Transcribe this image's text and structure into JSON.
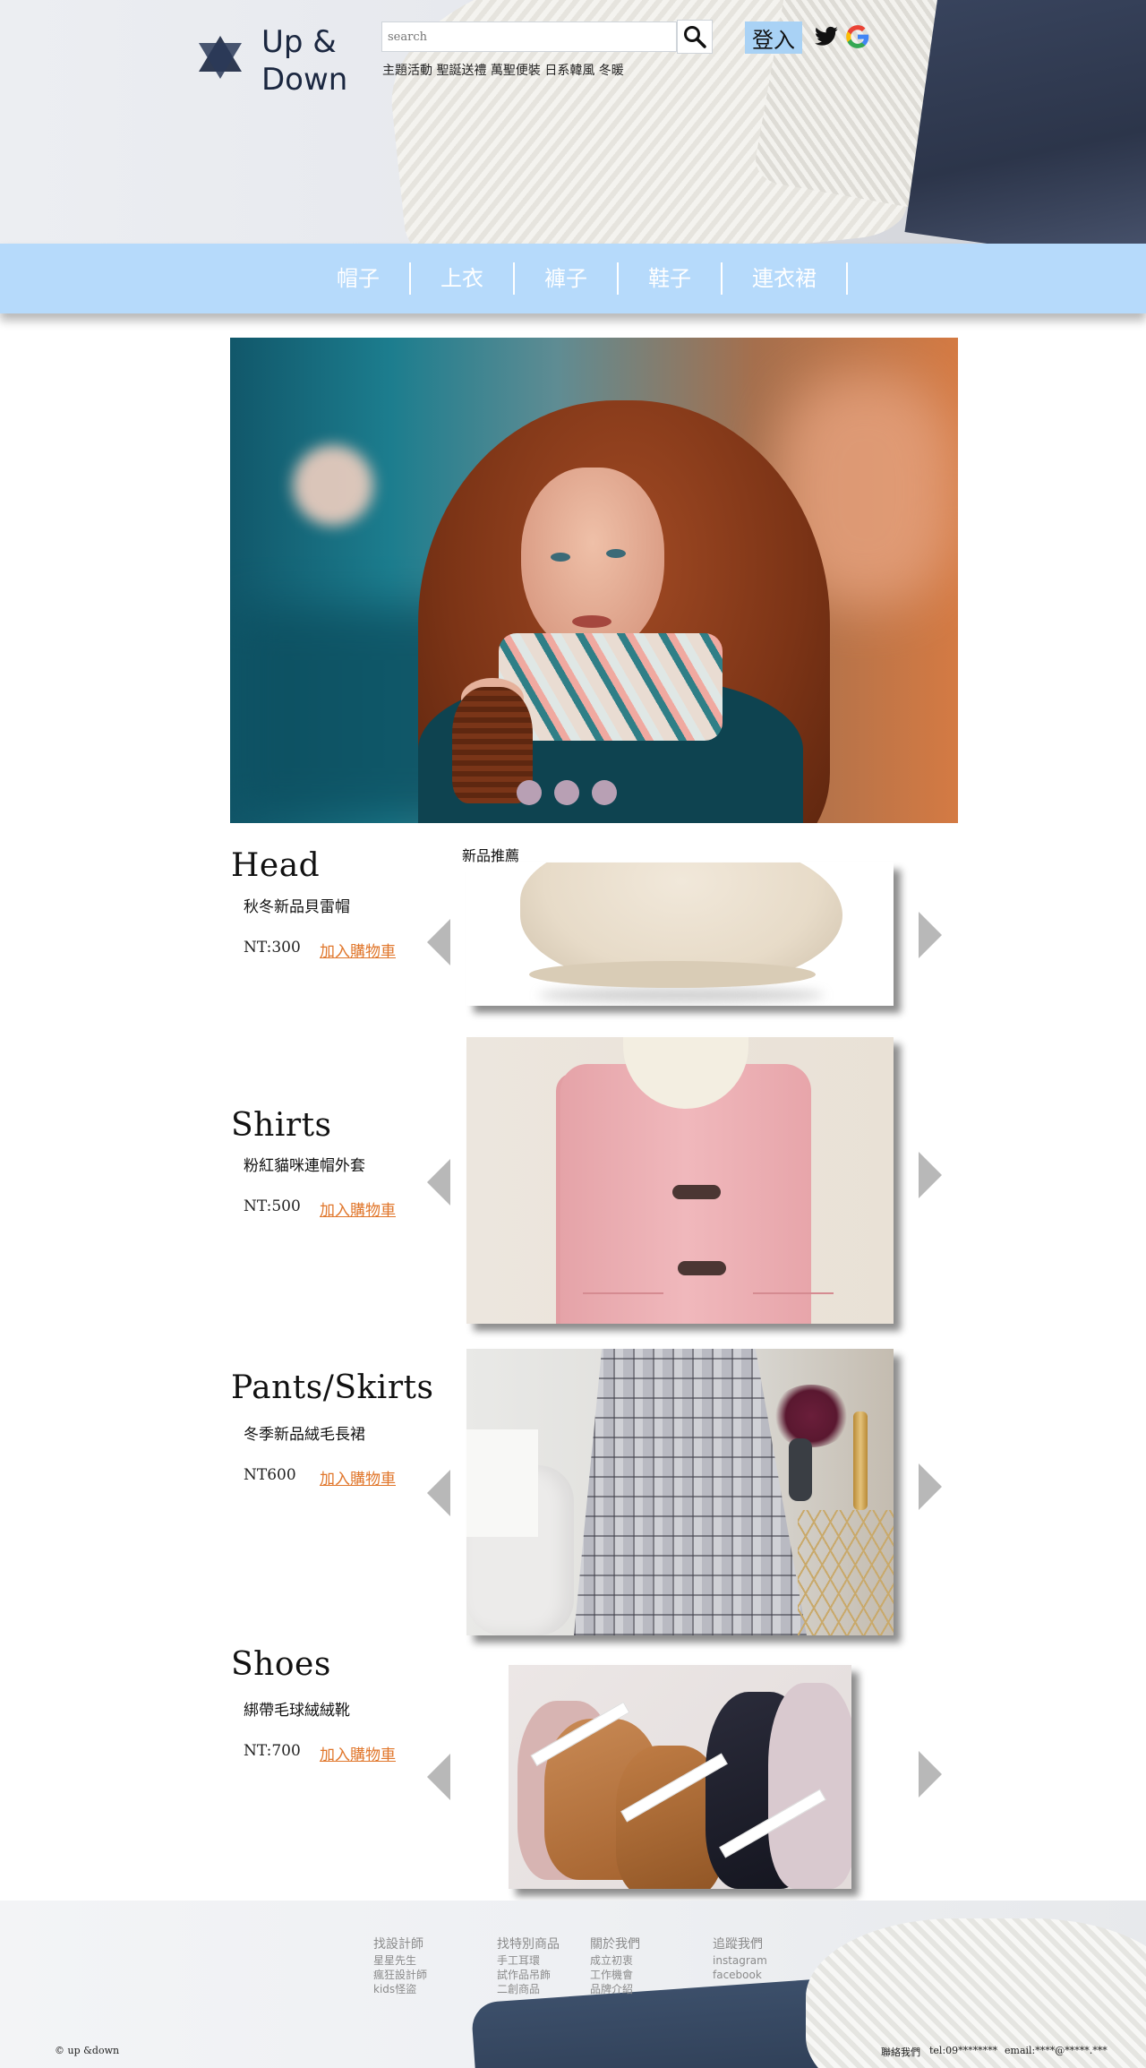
{
  "header": {
    "brand_line1": "Up &",
    "brand_line2": "Down",
    "search_placeholder": "search",
    "hot_tags": "主題活動 聖誕送禮 萬聖便裝 日系韓風 冬暖",
    "login_label": "登入",
    "icons": [
      "star-of-david-logo-icon",
      "search-icon",
      "twitter-icon",
      "google-icon"
    ]
  },
  "nav": {
    "items": [
      "帽子",
      "上衣",
      "褲子",
      "鞋子",
      "連衣裙"
    ]
  },
  "hero": {
    "slide_count": 3
  },
  "products": {
    "section_label": "新品推薦",
    "items": [
      {
        "category": "Head",
        "name": "秋冬新品貝雷帽",
        "price": "NT:300",
        "cart": "加入購物車"
      },
      {
        "category": "Shirts",
        "name": "粉紅貓咪連帽外套",
        "price": "NT:500",
        "cart": "加入購物車"
      },
      {
        "category": "Pants/Skirts",
        "name": "冬季新品絨毛長裙",
        "price": "NT600",
        "cart": "加入購物車"
      },
      {
        "category": "Shoes",
        "name": "綁帶毛球絨絨靴",
        "price": "NT:700",
        "cart": "加入購物車"
      }
    ]
  },
  "footer": {
    "columns": [
      {
        "title": "找設計師",
        "links": [
          "星星先生",
          "瘋狂設計師",
          "kids怪盜"
        ]
      },
      {
        "title": "找特別商品",
        "links": [
          "手工耳環",
          "試作品吊飾",
          "二創商品"
        ]
      },
      {
        "title": "關於我們",
        "links": [
          "成立初衷",
          "工作機會",
          "品牌介紹"
        ]
      },
      {
        "title": "追蹤我們",
        "links": [
          "instagram",
          "facebook"
        ]
      }
    ],
    "copyright": "© up &down",
    "contact_label": "聯絡我們",
    "tel": "tel:09********",
    "email": "email:****@*****.***"
  },
  "colors": {
    "nav_bg": "#b6dafb",
    "login_bg": "#a9d2f5",
    "cart_link": "#e0762b",
    "logo": "#1b2740"
  }
}
